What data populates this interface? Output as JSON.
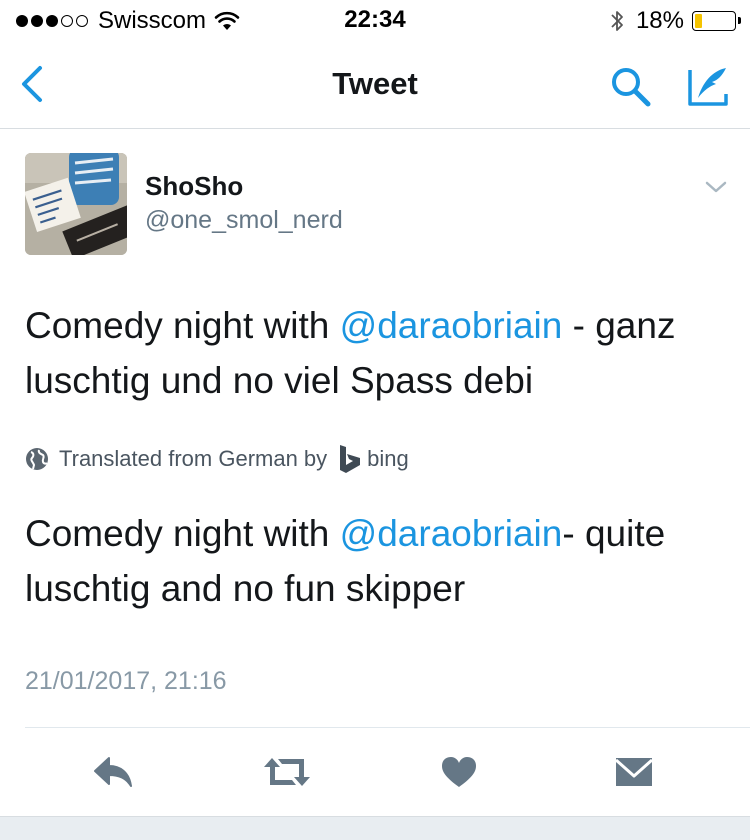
{
  "status_bar": {
    "carrier": "Swisscom",
    "time": "22:34",
    "battery": "18%",
    "battery_level": 0.18,
    "signal_bars": 3,
    "signal_total": 5
  },
  "nav": {
    "title": "Tweet"
  },
  "tweet": {
    "display_name": "ShoSho",
    "handle": "@one_smol_nerd",
    "text_before": "Comedy night with ",
    "mention": "@daraobriain",
    "text_after": " - ganz luschtig und no viel Spass debi",
    "translated_label": "Translated from German by",
    "translator": "bing",
    "translation_before": "Comedy night with ",
    "translation_mention": "@daraobriain",
    "translation_after": "- quite luschtig and no fun skipper",
    "timestamp": "21/01/2017, 21:16"
  },
  "icons": {
    "back": "chevron-left-icon",
    "search": "search-icon",
    "compose": "compose-icon",
    "caret": "chevron-down-icon",
    "globe": "globe-icon",
    "bing": "bing-logo-icon",
    "reply": "reply-icon",
    "retweet": "retweet-icon",
    "like": "heart-icon",
    "dm": "envelope-icon"
  },
  "colors": {
    "accent": "#1b95e0",
    "secondary_text": "#657786",
    "timestamp": "#8899a6",
    "action_icons": "#657786",
    "battery_fill": "#f5c400"
  }
}
